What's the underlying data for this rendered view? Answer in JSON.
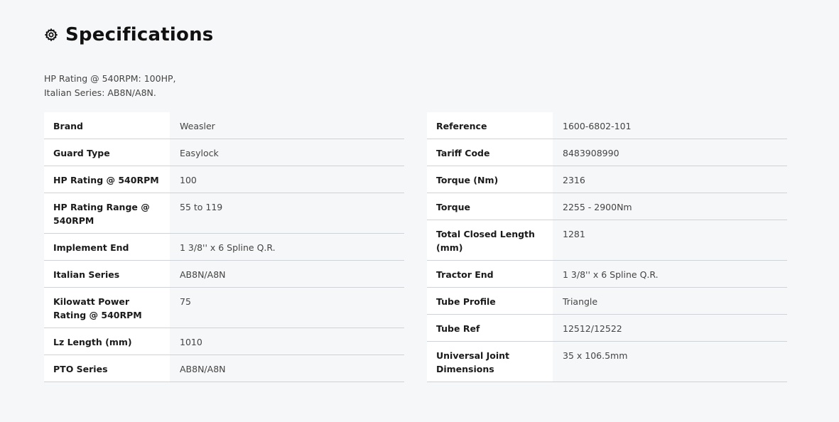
{
  "title": "Specifications",
  "summary": {
    "line1": "HP Rating @ 540RPM: 100HP,",
    "line2": "Italian Series: AB8N/A8N."
  },
  "left_table": [
    {
      "label": "Brand",
      "value": "Weasler"
    },
    {
      "label": "Guard Type",
      "value": "Easylock"
    },
    {
      "label": "HP Rating @ 540RPM",
      "value": "100"
    },
    {
      "label": "HP Rating Range @ 540RPM",
      "value": "55 to 119"
    },
    {
      "label": "Implement End",
      "value": "1 3/8'' x 6 Spline Q.R."
    },
    {
      "label": "Italian Series",
      "value": "AB8N/A8N"
    },
    {
      "label": "Kilowatt Power Rating @ 540RPM",
      "value": "75"
    },
    {
      "label": "Lz Length (mm)",
      "value": "1010"
    },
    {
      "label": "PTO Series",
      "value": "AB8N/A8N"
    }
  ],
  "right_table": [
    {
      "label": "Reference",
      "value": "1600-6802-101"
    },
    {
      "label": "Tariff Code",
      "value": "8483908990"
    },
    {
      "label": "Torque (Nm)",
      "value": "2316"
    },
    {
      "label": "Torque",
      "value": "2255 - 2900Nm"
    },
    {
      "label": "Total Closed Length (mm)",
      "value": "1281"
    },
    {
      "label": "Tractor End",
      "value": "1 3/8'' x 6 Spline Q.R."
    },
    {
      "label": "Tube Profile",
      "value": "Triangle"
    },
    {
      "label": "Tube Ref",
      "value": "12512/12522"
    },
    {
      "label": "Universal Joint Dimensions",
      "value": "35 x 106.5mm"
    }
  ],
  "icons": {
    "heading": "gear-icon"
  }
}
